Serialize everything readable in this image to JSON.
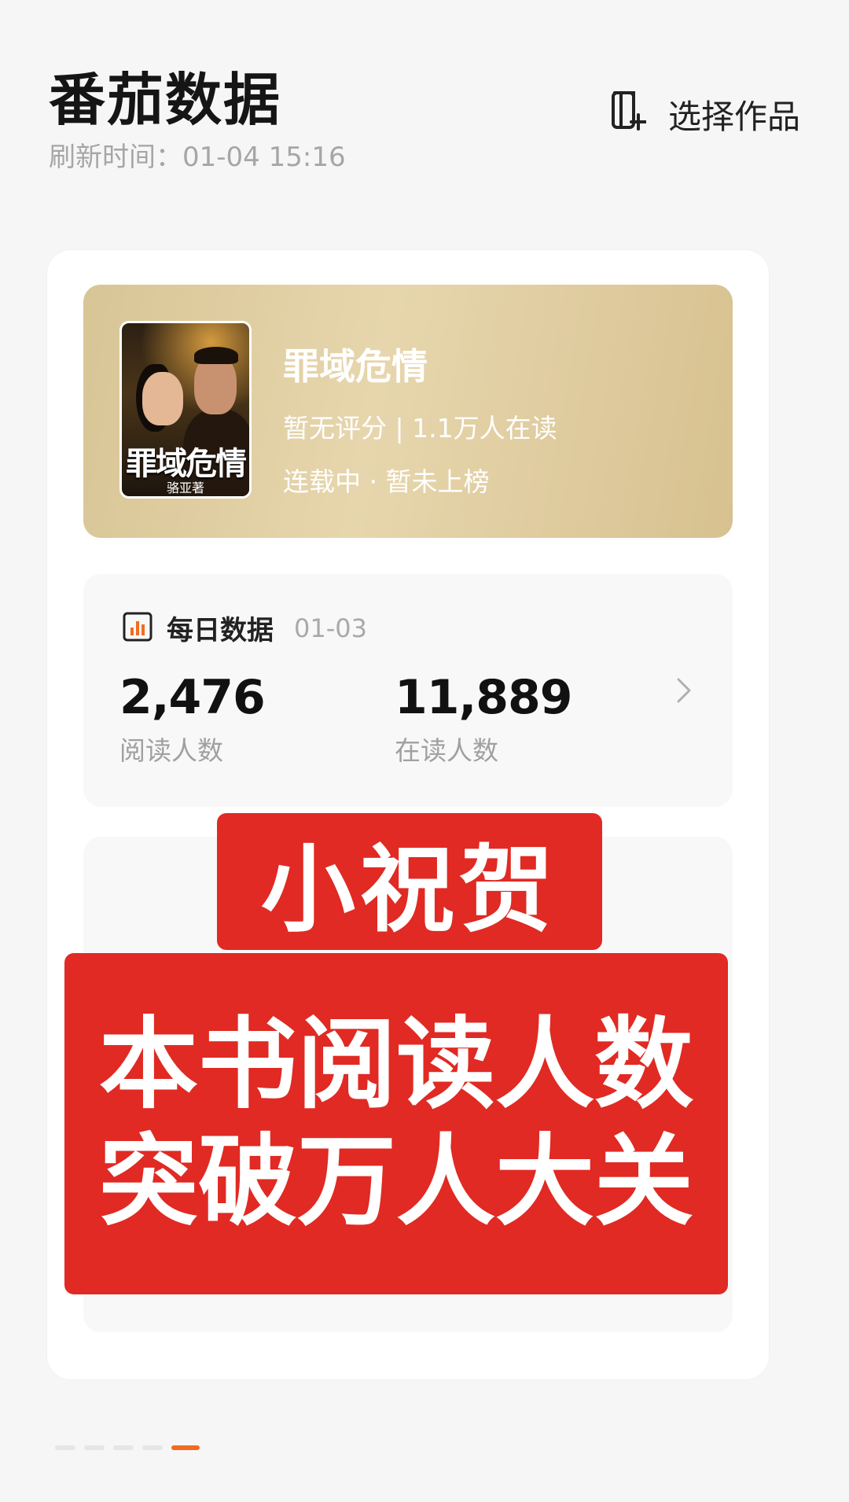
{
  "header": {
    "title": "番茄数据",
    "refresh_text": "刷新时间：01-04 15:16",
    "select_works_label": "选择作品"
  },
  "book": {
    "title": "罪域危情",
    "cover_title": "罪域危情",
    "cover_author": "骆亚著",
    "rating_line": "暂无评分 | 1.1万人在读",
    "status_line": "连载中 · 暂未上榜"
  },
  "daily": {
    "title": "每日数据",
    "date": "01-03",
    "reading_count": "2,476",
    "reading_label": "阅读人数",
    "in_reading_count": "11,889",
    "in_reading_label": "在读人数"
  },
  "overlay": {
    "top_text": "小祝贺",
    "line1": "本书阅读人数",
    "line2": "突破万人大关"
  },
  "pager": {
    "count": 5,
    "active_index": 4
  },
  "colors": {
    "accent": "#f36b21",
    "overlay_red": "#e02a23",
    "banner_gold": "#d8c596"
  }
}
